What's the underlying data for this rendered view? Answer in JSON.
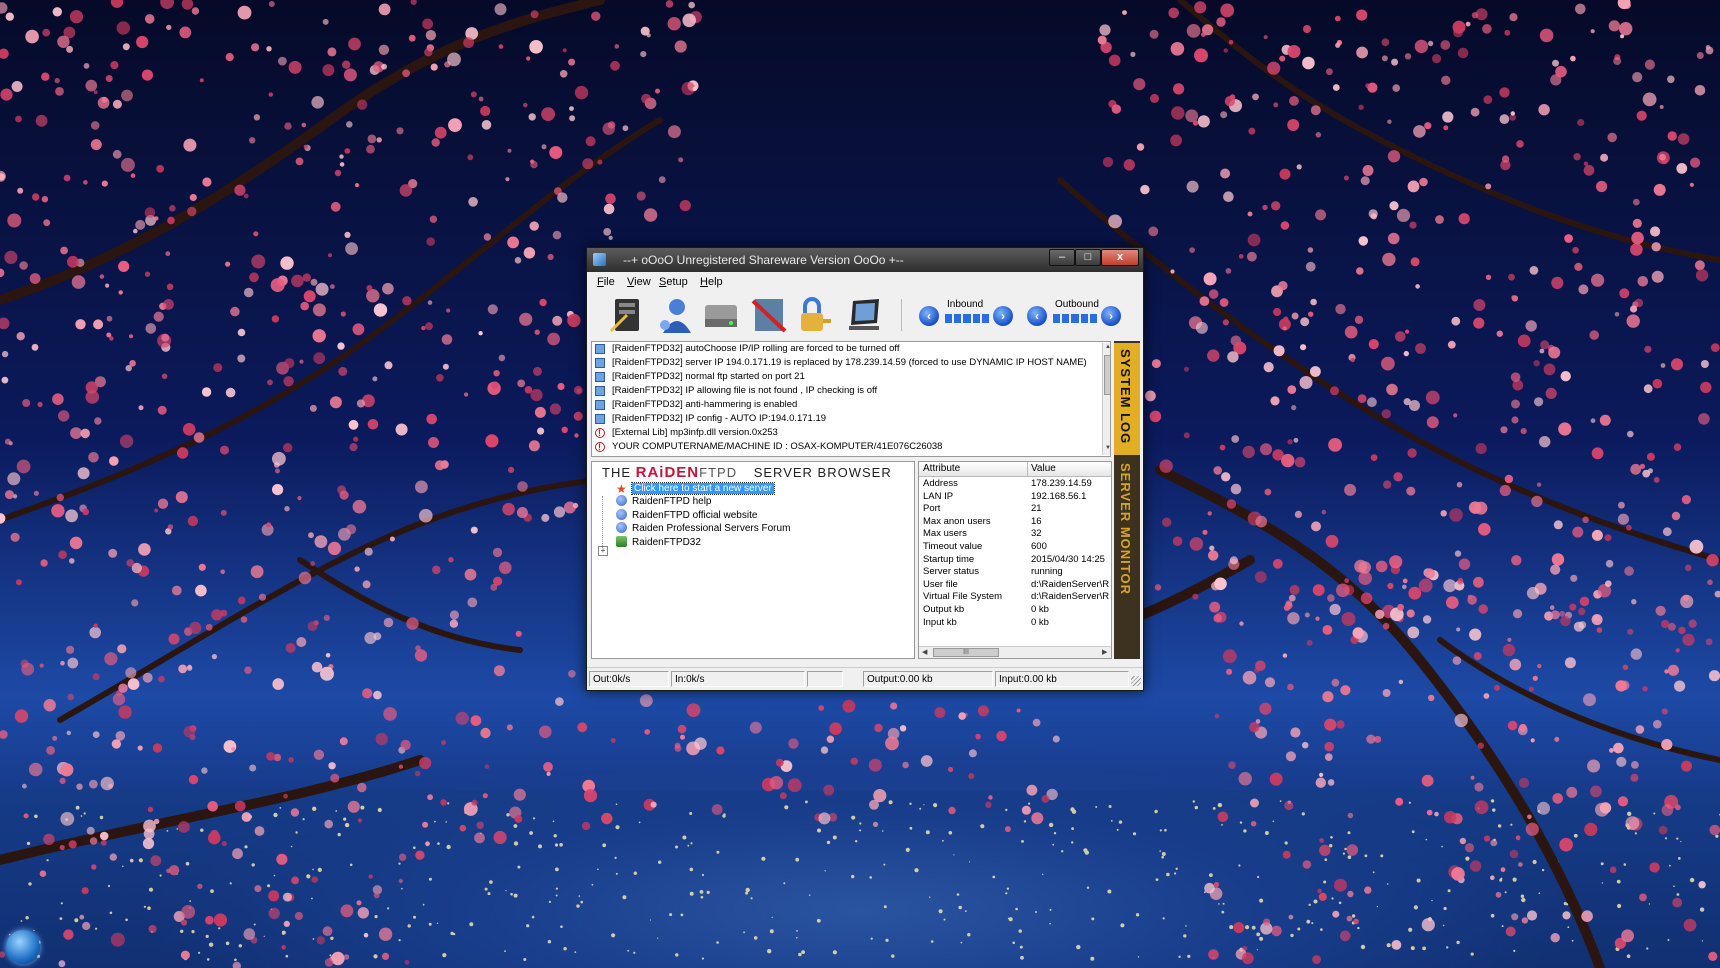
{
  "window": {
    "title": "--+ oOoO Unregistered Shareware Version OoOo +--",
    "buttons": {
      "minimize": "–",
      "maximize": "□",
      "close": "x"
    }
  },
  "menu": [
    "File",
    "View",
    "Setup",
    "Help"
  ],
  "toolbar": {
    "icons": [
      "server-settings-icon",
      "users-icon",
      "disk-icon",
      "block-icon",
      "lock-key-icon",
      "monitor-icon"
    ],
    "inbound_label": "Inbound",
    "outbound_label": "Outbound"
  },
  "log": [
    {
      "type": "info",
      "text": "[RaidenFTPD32] autoChoose IP/IP rolling are forced to be turned off"
    },
    {
      "type": "info",
      "text": "[RaidenFTPD32] server IP 194.0.171.19 is replaced by 178.239.14.59 (forced to use DYNAMIC IP HOST NAME)"
    },
    {
      "type": "info",
      "text": "[RaidenFTPD32] normal ftp started on port 21"
    },
    {
      "type": "info",
      "text": "[RaidenFTPD32] IP allowing file is not found , IP checking is off"
    },
    {
      "type": "info",
      "text": "[RaidenFTPD32] anti-hammering is enabled"
    },
    {
      "type": "info",
      "text": "[RaidenFTPD32] IP config - AUTO IP:194.0.171.19"
    },
    {
      "type": "error",
      "text": "[External Lib] mp3infp.dll version.0x253"
    },
    {
      "type": "error",
      "text": "YOUR COMPUTERNAME/MACHINE ID : OSAX-KOMPUTER/41E076C26038"
    }
  ],
  "side_tabs": {
    "log": "SYSTEM LOG",
    "monitor": "SERVER MONITOR"
  },
  "browser": {
    "brand_the": "THE",
    "brand_raiden": "RAiDEN",
    "brand_ftpd": "FTPD",
    "brand_rest": "SERVER BROWSER",
    "items": [
      {
        "label": "Click here to start a new server",
        "icon": "star-icon",
        "selected": true
      },
      {
        "label": "RaidenFTPD help",
        "icon": "globe-icon"
      },
      {
        "label": "RaidenFTPD official website",
        "icon": "globe-icon"
      },
      {
        "label": "Raiden Professional Servers Forum",
        "icon": "globe-icon"
      },
      {
        "label": "RaidenFTPD32",
        "icon": "server-icon"
      }
    ],
    "expander": "+"
  },
  "attributes": {
    "header_attr": "Attribute",
    "header_value": "Value",
    "rows": [
      {
        "attr": "Address",
        "value": "178.239.14.59"
      },
      {
        "attr": "LAN IP",
        "value": "192.168.56.1"
      },
      {
        "attr": "Port",
        "value": "21"
      },
      {
        "attr": "Max anon users",
        "value": "16"
      },
      {
        "attr": "Max users",
        "value": "32"
      },
      {
        "attr": "Timeout value",
        "value": "600"
      },
      {
        "attr": "Startup time",
        "value": "2015/04/30 14:25"
      },
      {
        "attr": "Server status",
        "value": "running"
      },
      {
        "attr": "User file",
        "value": "d:\\RaidenServer\\R"
      },
      {
        "attr": "Virtual File System",
        "value": "d:\\RaidenServer\\R"
      },
      {
        "attr": "Output kb",
        "value": "0 kb"
      },
      {
        "attr": "Input kb",
        "value": "0 kb"
      }
    ],
    "scroll_thumb": "III"
  },
  "status": {
    "out_speed": "Out:0k/s",
    "in_speed": "In:0k/s",
    "output": "Output:0.00 kb",
    "input": "Input:0.00 kb"
  }
}
